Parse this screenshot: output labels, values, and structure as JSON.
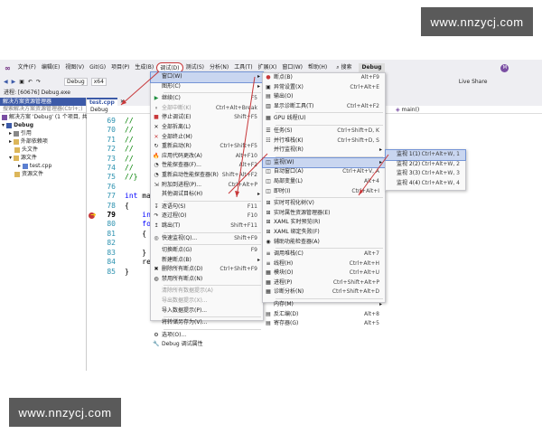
{
  "watermark": {
    "top": "www.nnzycj.com",
    "bottom": "www.nnzycj.com"
  },
  "menubar": {
    "items": [
      "文件(F)",
      "编辑(E)",
      "视图(V)",
      "Git(G)",
      "项目(P)",
      "生成(B)",
      "调试(D)",
      "测试(S)",
      "分析(N)",
      "工具(T)",
      "扩展(X)",
      "窗口(W)",
      "帮助(H)"
    ],
    "search": "搜索",
    "solution": "Debug",
    "liveshare": "Live Share",
    "avatar": "M"
  },
  "toolbar": {
    "config": "Debug",
    "platform": "x64",
    "process": "进程: [60676] Debug.exe"
  },
  "solution_explorer": {
    "title": "解决方案资源管理器",
    "search": "搜索解决方案资源管理器(Ctrl+;)",
    "items": [
      "解决方案 'Debug' (1 个项目, 共",
      "Debug",
      "引用",
      "外部依赖项",
      "头文件",
      "源文件",
      "test.cpp",
      "资源文件"
    ]
  },
  "editor": {
    "tab": "test.cpp",
    "nav_left": "Debug",
    "nav_right": "main()",
    "lines": [
      "69",
      "70",
      "71",
      "72",
      "73",
      "74",
      "75",
      "76",
      "77",
      "78",
      "79",
      "80",
      "81",
      "82",
      "83",
      "84",
      "85"
    ]
  },
  "debug_menu": {
    "items": [
      {
        "label": "窗口(W)",
        "shortcut": "",
        "arrow": "▸",
        "sel": true
      },
      {
        "label": "图形(C)",
        "shortcut": "",
        "arrow": "▸"
      },
      {
        "sep": true
      },
      {
        "label": "继续(C)",
        "shortcut": "F5",
        "icon": "▶",
        "color": "#1e8e3e"
      },
      {
        "label": "全部中断(K)",
        "shortcut": "Ctrl+Alt+Break",
        "dis": true,
        "icon": "⏸"
      },
      {
        "label": "停止调试(E)",
        "shortcut": "Shift+F5",
        "icon": "■",
        "color": "#c8383a"
      },
      {
        "label": "全部拆离(L)",
        "shortcut": "",
        "icon": "✕"
      },
      {
        "label": "全部终止(M)",
        "shortcut": "",
        "icon": "✕",
        "color": "#c8383a"
      },
      {
        "label": "重新启动(R)",
        "shortcut": "Ctrl+Shift+F5",
        "icon": "↻"
      },
      {
        "label": "应用代码更改(A)",
        "shortcut": "Alt+F10",
        "icon": "🔥"
      },
      {
        "label": "性能探查器(F)...",
        "shortcut": "Alt+F2",
        "icon": "◔"
      },
      {
        "label": "重新启动性能探查器(R)",
        "shortcut": "Shift+Alt+F2",
        "icon": "◔"
      },
      {
        "label": "附加到进程(P)...",
        "shortcut": "Ctrl+Alt+P",
        "icon": "⇲"
      },
      {
        "label": "其他调试目标(H)",
        "shortcut": "",
        "arrow": "▸"
      },
      {
        "sep": true
      },
      {
        "label": "逐语句(S)",
        "shortcut": "F11",
        "icon": "↧"
      },
      {
        "label": "逐过程(O)",
        "shortcut": "F10",
        "icon": "↷"
      },
      {
        "label": "跳出(T)",
        "shortcut": "Shift+F11",
        "icon": "↥"
      },
      {
        "sep": true
      },
      {
        "label": "快速监视(Q)...",
        "shortcut": "Shift+F9",
        "icon": "◎"
      },
      {
        "sep": true
      },
      {
        "label": "切换断点(G)",
        "shortcut": "F9"
      },
      {
        "label": "新建断点(B)",
        "shortcut": "",
        "arrow": "▸"
      },
      {
        "label": "删除所有断点(D)",
        "shortcut": "Ctrl+Shift+F9",
        "icon": "✖"
      },
      {
        "label": "禁用所有断点(N)",
        "shortcut": "",
        "icon": "◍"
      },
      {
        "sep": true
      },
      {
        "label": "清除所有数据提示(A)",
        "shortcut": "",
        "dis": true
      },
      {
        "label": "导出数据提示(X)...",
        "shortcut": "",
        "dis": true
      },
      {
        "label": "导入数据提示(P)...",
        "shortcut": ""
      },
      {
        "sep": true
      },
      {
        "label": "将转储另存为(V)...",
        "shortcut": ""
      },
      {
        "sep": true
      },
      {
        "label": "选项(O)...",
        "shortcut": "",
        "icon": "⚙"
      },
      {
        "label": "Debug 调试属性",
        "shortcut": "",
        "icon": "🔧"
      }
    ]
  },
  "window_menu": {
    "items": [
      {
        "label": "断点(B)",
        "shortcut": "Alt+F9",
        "icon": "●",
        "color": "#c8383a"
      },
      {
        "label": "异常设置(X)",
        "shortcut": "Ctrl+Alt+E",
        "icon": "▣"
      },
      {
        "label": "输出(O)",
        "shortcut": "",
        "icon": "▤"
      },
      {
        "label": "显示诊断工具(T)",
        "shortcut": "Ctrl+Alt+F2",
        "icon": "▥"
      },
      {
        "sep": true
      },
      {
        "label": "GPU 线程(U)",
        "shortcut": "",
        "icon": "▦"
      },
      {
        "sep": true
      },
      {
        "label": "任务(S)",
        "shortcut": "Ctrl+Shift+D, K",
        "icon": "☰"
      },
      {
        "label": "并行堆栈(K)",
        "shortcut": "Ctrl+Shift+D, S",
        "icon": "☷"
      },
      {
        "label": "并行监视(R)",
        "shortcut": "",
        "arrow": "▸"
      },
      {
        "sep": true
      },
      {
        "label": "监视(W)",
        "shortcut": "",
        "arrow": "▸",
        "sel": true,
        "icon": "◫"
      },
      {
        "label": "自动窗口(A)",
        "shortcut": "Ctrl+Alt+V, A",
        "icon": "◫"
      },
      {
        "label": "局部变量(L)",
        "shortcut": "Alt+4",
        "icon": "◫"
      },
      {
        "label": "即时(I)",
        "shortcut": "Ctrl+Alt+I",
        "icon": "◫"
      },
      {
        "sep": true
      },
      {
        "label": "实时可视化树(V)",
        "shortcut": "",
        "icon": "⊞"
      },
      {
        "label": "实时属性资源管理器(E)",
        "shortcut": "",
        "icon": "⊞"
      },
      {
        "label": "XAML 实时预览(R)",
        "shortcut": "",
        "icon": "⊞"
      },
      {
        "label": "XAML 绑定失败(F)",
        "shortcut": "",
        "icon": "⊞"
      },
      {
        "label": "辅助功能检查器(A)",
        "shortcut": "",
        "icon": "◉"
      },
      {
        "sep": true
      },
      {
        "label": "调用堆栈(C)",
        "shortcut": "Alt+7",
        "icon": "≡"
      },
      {
        "label": "线程(H)",
        "shortcut": "Ctrl+Alt+H",
        "icon": "≡"
      },
      {
        "label": "模块(O)",
        "shortcut": "Ctrl+Alt+U",
        "icon": "▦"
      },
      {
        "label": "进程(P)",
        "shortcut": "Ctrl+Shift+Alt+P",
        "icon": "▦"
      },
      {
        "label": "诊断分析(N)",
        "shortcut": "Ctrl+Shift+Alt+D",
        "icon": "▦"
      },
      {
        "sep": true
      },
      {
        "label": "内存(M)",
        "shortcut": "",
        "arrow": "▸"
      },
      {
        "label": "反汇编(D)",
        "shortcut": "Alt+8",
        "icon": "▤"
      },
      {
        "label": "寄存器(G)",
        "shortcut": "Alt+5",
        "icon": "▤"
      }
    ]
  },
  "watch_menu": {
    "items": [
      {
        "label": "监视 1(1)",
        "shortcut": "Ctrl+Alt+W, 1",
        "sel": true
      },
      {
        "label": "监视 2(2)",
        "shortcut": "Ctrl+Alt+W, 2"
      },
      {
        "label": "监视 3(3)",
        "shortcut": "Ctrl+Alt+W, 3"
      },
      {
        "label": "监视 4(4)",
        "shortcut": "Ctrl+Alt+W, 4"
      }
    ]
  },
  "colors": {
    "accent": "#3c5aa8",
    "highlight": "#c8383a"
  }
}
